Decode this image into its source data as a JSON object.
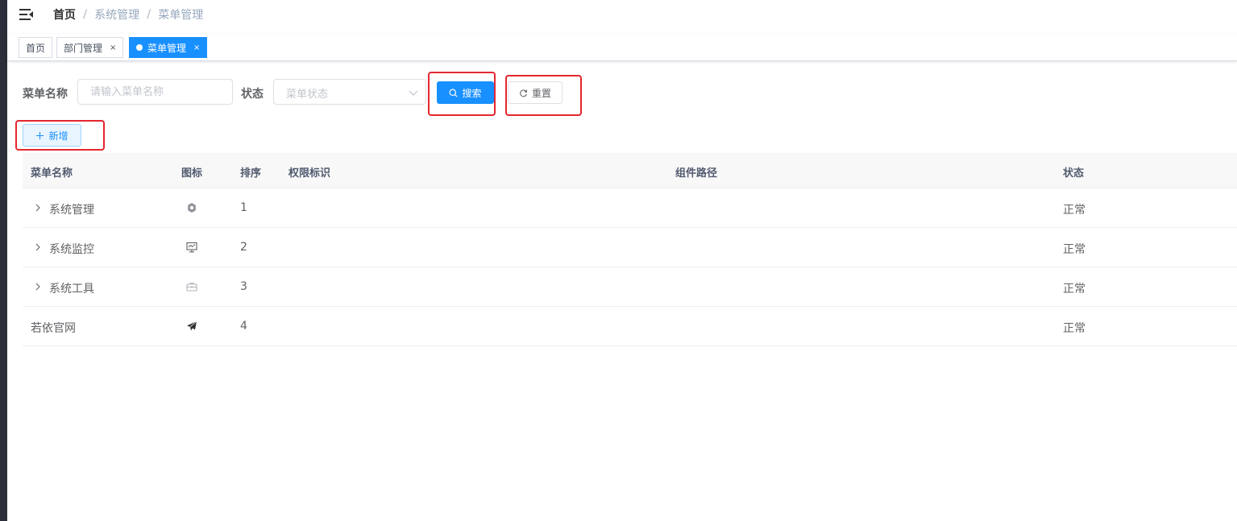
{
  "navbar": {
    "breadcrumb": [
      "首页",
      "系统管理",
      "菜单管理"
    ],
    "separator": "/"
  },
  "tags": [
    {
      "label": "首页",
      "closable": false,
      "active": false
    },
    {
      "label": "部门管理",
      "closable": true,
      "active": false
    },
    {
      "label": "菜单管理",
      "closable": true,
      "active": true
    }
  ],
  "tag_close": "×",
  "search": {
    "menu_name_label": "菜单名称",
    "menu_name_placeholder": "请输入菜单名称",
    "status_label": "状态",
    "status_placeholder": "菜单状态",
    "search_button": "搜索",
    "reset_button": "重置"
  },
  "toolbar": {
    "add_button": "新增"
  },
  "table": {
    "columns": [
      "菜单名称",
      "图标",
      "排序",
      "权限标识",
      "组件路径",
      "状态"
    ],
    "rows": [
      {
        "name": "系统管理",
        "icon": "gear-icon",
        "order": "1",
        "perms": "",
        "component": "",
        "status": "正常",
        "expandable": true
      },
      {
        "name": "系统监控",
        "icon": "monitor-icon",
        "order": "2",
        "perms": "",
        "component": "",
        "status": "正常",
        "expandable": true
      },
      {
        "name": "系统工具",
        "icon": "toolbox-icon",
        "order": "3",
        "perms": "",
        "component": "",
        "status": "正常",
        "expandable": true
      },
      {
        "name": "若依官网",
        "icon": "paper-plane-icon",
        "order": "4",
        "perms": "",
        "component": "",
        "status": "正常",
        "expandable": false
      }
    ]
  },
  "colors": {
    "primary": "#1890ff",
    "highlight": "#e5262f",
    "sidebar": "#2b2f3a"
  }
}
